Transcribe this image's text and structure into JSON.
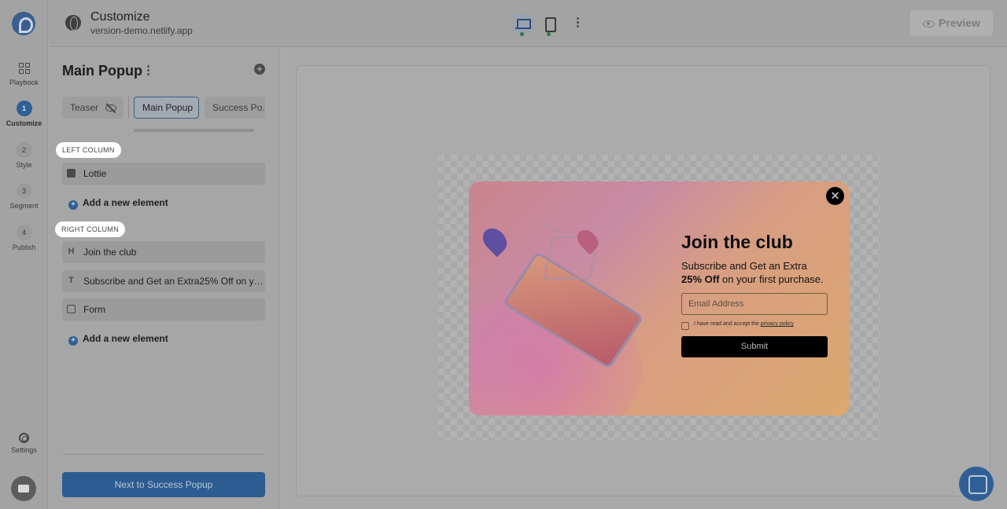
{
  "rail": {
    "items": [
      {
        "label": "Playbook",
        "type": "grid"
      },
      {
        "label": "Customize",
        "num": "1"
      },
      {
        "label": "Style",
        "num": "2"
      },
      {
        "label": "Segment",
        "num": "3"
      },
      {
        "label": "Publish",
        "num": "4"
      }
    ],
    "settings_label": "Settings"
  },
  "topbar": {
    "title": "Customize",
    "subtitle": "version-demo.netlify.app",
    "preview_label": "Preview"
  },
  "panel": {
    "title": "Main Popup",
    "tabs": [
      {
        "label": "Teaser"
      },
      {
        "label": "Main Popup"
      },
      {
        "label": "Success Po..."
      }
    ],
    "left_column_label": "LEFT COLUMN",
    "left_items": [
      {
        "label": "Lottie",
        "icon": "lottie-icon"
      }
    ],
    "add_element_label": "Add a new element",
    "right_column_label": "RIGHT COLUMN",
    "right_items": [
      {
        "label": "Join the club",
        "icon": "heading-icon",
        "glyph": "H"
      },
      {
        "label": "Subscribe and Get an Extra25% Off on your first purchase.",
        "icon": "text-icon",
        "glyph": "T"
      },
      {
        "label": "Form",
        "icon": "form-icon"
      }
    ],
    "next_button_label": "Next to Success Popup"
  },
  "popup": {
    "title": "Join the club",
    "line1": "Subscribe and Get an Extra",
    "line2_bold": "25% Off",
    "line2_rest": " on your first purchase.",
    "email_placeholder": "Email Address",
    "consent_text": "I have read and accept the ",
    "consent_link": "privacy policy",
    "submit_label": "Submit",
    "close_glyph": "✕"
  },
  "colors": {
    "accent": "#2f5f95",
    "popup_gradient_start": "#c9858d",
    "popup_gradient_end": "#dba86e"
  }
}
